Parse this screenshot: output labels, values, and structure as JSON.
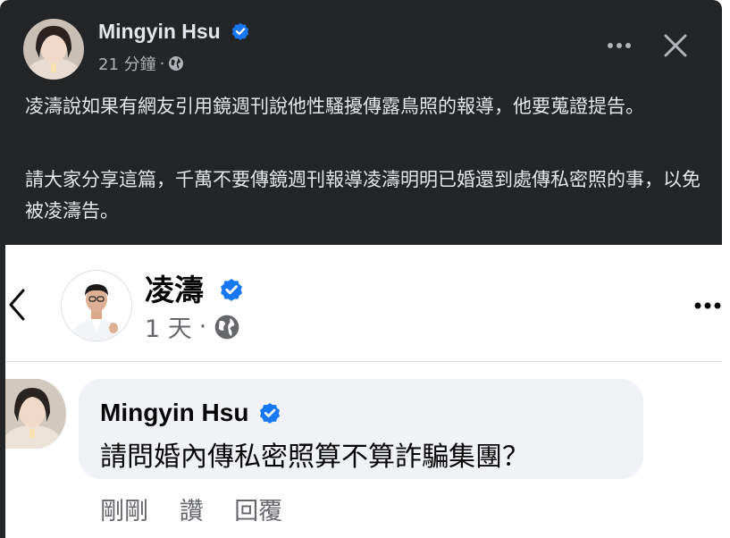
{
  "post": {
    "author": "Mingyin Hsu",
    "time": "21 分鐘",
    "separator": "·",
    "paragraphs": [
      "凌濤說如果有網友引用鏡週刊說他性騷擾傳露鳥照的報導，他要蒐證提告。",
      "請大家分享這篇，千萬不要傳鏡週刊報導凌濤明明已婚還到處傳私密照的事，以免被凌濤告。"
    ],
    "icons": {
      "verified": "verified-badge-icon",
      "audience": "globe-icon",
      "more": "more-options-icon",
      "close": "close-icon"
    }
  },
  "embedded": {
    "page_name": "凌濤",
    "time": "1 天",
    "separator": "·",
    "comment": {
      "author": "Mingyin Hsu",
      "text": "請問婚內傳私密照算不算詐騙集團？",
      "actions": [
        "剛剛",
        "讚",
        "回覆"
      ]
    }
  },
  "colors": {
    "dark_bg": "#242526",
    "text_light": "#e4e6eb",
    "meta_gray": "#b0b3b8",
    "verified_blue": "#1877f2",
    "bubble_bg": "#f0f2f5"
  }
}
